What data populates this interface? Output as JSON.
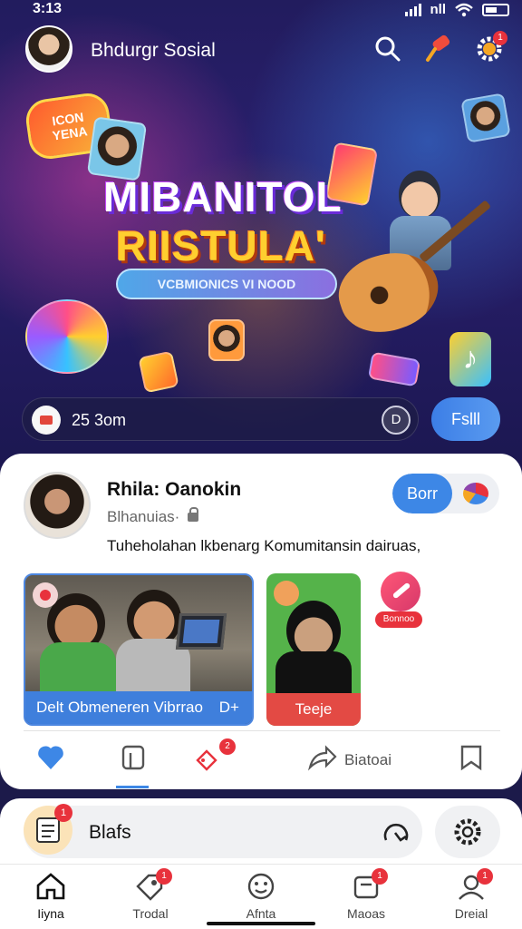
{
  "status_bar": {
    "time": "3:13",
    "network": "nll"
  },
  "header": {
    "app_title": "Bhdurgr Sosial",
    "notification_count": "1"
  },
  "banner": {
    "bubble_text_1": "ICON",
    "bubble_text_2": "YENA",
    "title_line1": "MIBANITOL",
    "title_line2": "RIISTULA'",
    "subtitle": "VCBMIONICS VI NOOD",
    "count": "25 3om",
    "play_label": "D",
    "follow_label": "Fslll"
  },
  "post": {
    "author": "Rhila: Oanokin",
    "handle": "Blhanuias·",
    "text": "Tuheholahan lkbenarg Komumitansin dairuas,",
    "follow_label": "Borr",
    "media": [
      {
        "caption": "Delt Obmeneren Vibrrao",
        "caption_icon": "D+"
      },
      {
        "caption": "Teeje"
      }
    ],
    "side_tag": "Bonnoo",
    "actions": {
      "comment_badge": "2",
      "share_label": "Biatoai"
    }
  },
  "chat": {
    "label": "Blafs",
    "badge": "1"
  },
  "bottom_nav": [
    {
      "label": "Iiyna"
    },
    {
      "label": "Trodal",
      "badge": "1"
    },
    {
      "label": "Afnta"
    },
    {
      "label": "Maoas",
      "badge": "1"
    },
    {
      "label": "Dreial",
      "badge": "1"
    }
  ],
  "colors": {
    "accent": "#3d87e6",
    "badge": "#e8323c",
    "hero_bg": "#221c5e"
  }
}
